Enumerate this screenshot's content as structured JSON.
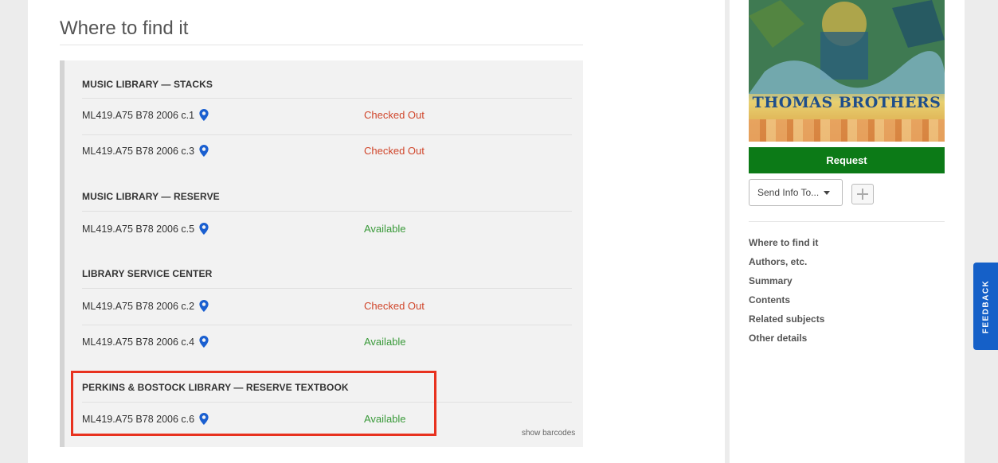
{
  "main": {
    "section_title": "Where to find it",
    "locations": [
      {
        "name": "MUSIC LIBRARY — STACKS",
        "items": [
          {
            "call_number": "ML419.A75 B78 2006 c.1",
            "status": "Checked Out"
          },
          {
            "call_number": "ML419.A75 B78 2006 c.3",
            "status": "Checked Out"
          }
        ]
      },
      {
        "name": "MUSIC LIBRARY — RESERVE",
        "items": [
          {
            "call_number": "ML419.A75 B78 2006 c.5",
            "status": "Available"
          }
        ]
      },
      {
        "name": "LIBRARY SERVICE CENTER",
        "items": [
          {
            "call_number": "ML419.A75 B78 2006 c.2",
            "status": "Checked Out"
          },
          {
            "call_number": "ML419.A75 B78 2006 c.4",
            "status": "Available"
          }
        ]
      },
      {
        "name": "PERKINS & BOSTOCK LIBRARY — RESERVE TEXTBOOK",
        "items": [
          {
            "call_number": "ML419.A75 B78 2006 c.6",
            "status": "Available"
          }
        ]
      }
    ],
    "show_barcodes_label": "show barcodes"
  },
  "sidebar": {
    "cover_author_text": "THOMAS BROTHERS",
    "request_label": "Request",
    "send_info_label": "Send Info To...",
    "nav": [
      "Where to find it",
      "Authors, etc.",
      "Summary",
      "Contents",
      "Related subjects",
      "Other details"
    ]
  },
  "feedback_label": "FEEDBACK",
  "colors": {
    "checked_out": "#d0462b",
    "available": "#3a9a3a",
    "request_button": "#0c7a17",
    "feedback_tab": "#1560c8",
    "highlight_box": "#e8321f"
  }
}
